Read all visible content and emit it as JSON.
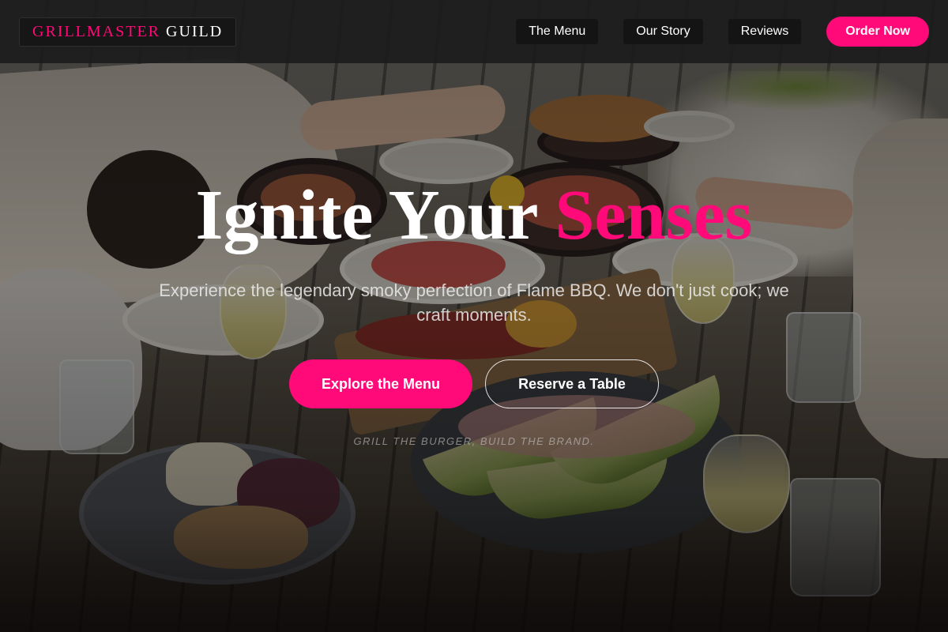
{
  "brand": {
    "part1": "GRILLMASTER",
    "part2": "GUILD"
  },
  "nav": {
    "links": [
      "The Menu",
      "Our Story",
      "Reviews"
    ],
    "cta": "Order Now"
  },
  "hero": {
    "title_main": "Ignite Your",
    "title_accent": "Senses",
    "subtitle": "Experience the legendary smoky perfection of Flame BBQ. We don't just cook; we craft moments.",
    "primary_button": "Explore the Menu",
    "secondary_button": "Reserve a Table",
    "tagline": "GRILL THE BURGER, BUILD THE BRAND."
  },
  "colors": {
    "accent": "#ff0a78",
    "header_bg": "#1c1c1c",
    "text": "#ffffff"
  }
}
